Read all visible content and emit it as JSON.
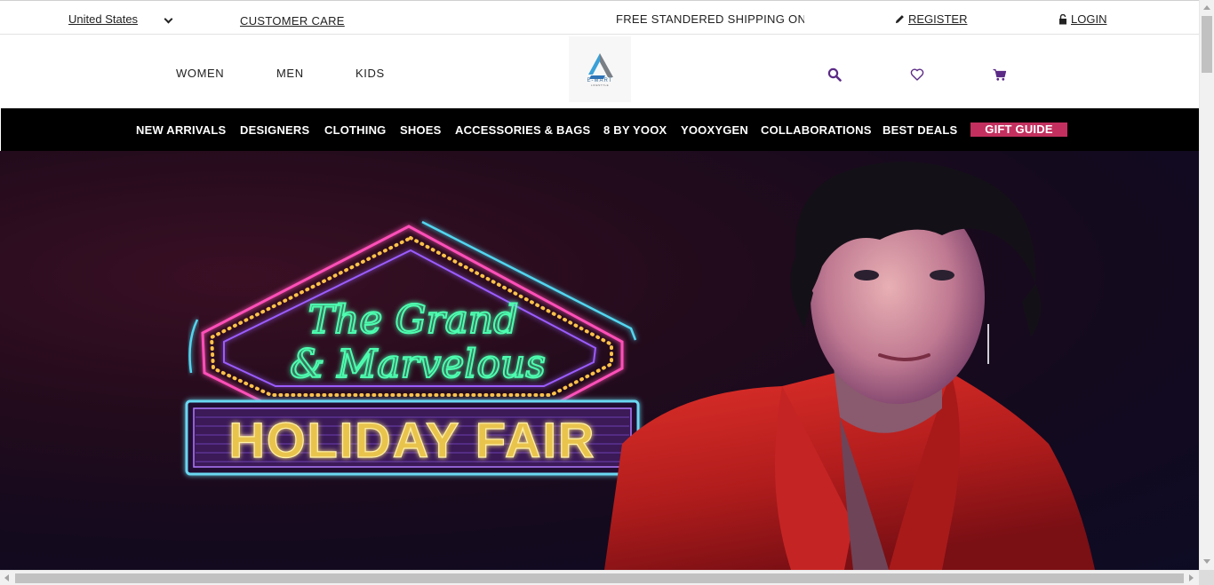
{
  "topbar": {
    "country": "United States",
    "customer_care": "CUSTOMER CARE",
    "shipping": "FREE STANDERED SHIPPING ON",
    "register": "REGISTER",
    "login": "LOGIN"
  },
  "header": {
    "genders": [
      "WOMEN",
      "MEN",
      "KIDS"
    ],
    "logo_word": "E-MART",
    "logo_sub": "LIFESTYLE",
    "icon_color": "#5b2a86"
  },
  "nav": {
    "items": [
      "NEW ARRIVALS",
      "DESIGNERS",
      "CLOTHING",
      "SHOES",
      "ACCESSORIES & BAGS",
      "8 BY YOOX",
      "YOOXYGEN",
      "COLLABORATIONS",
      "BEST DEALS"
    ],
    "gift_guide": "GIFT GUIDE",
    "gift_guide_color": "#c3305f"
  },
  "hero": {
    "line1": "The Grand",
    "line2": "& Marvelous",
    "sign": "HOLIDAY FAIR"
  }
}
